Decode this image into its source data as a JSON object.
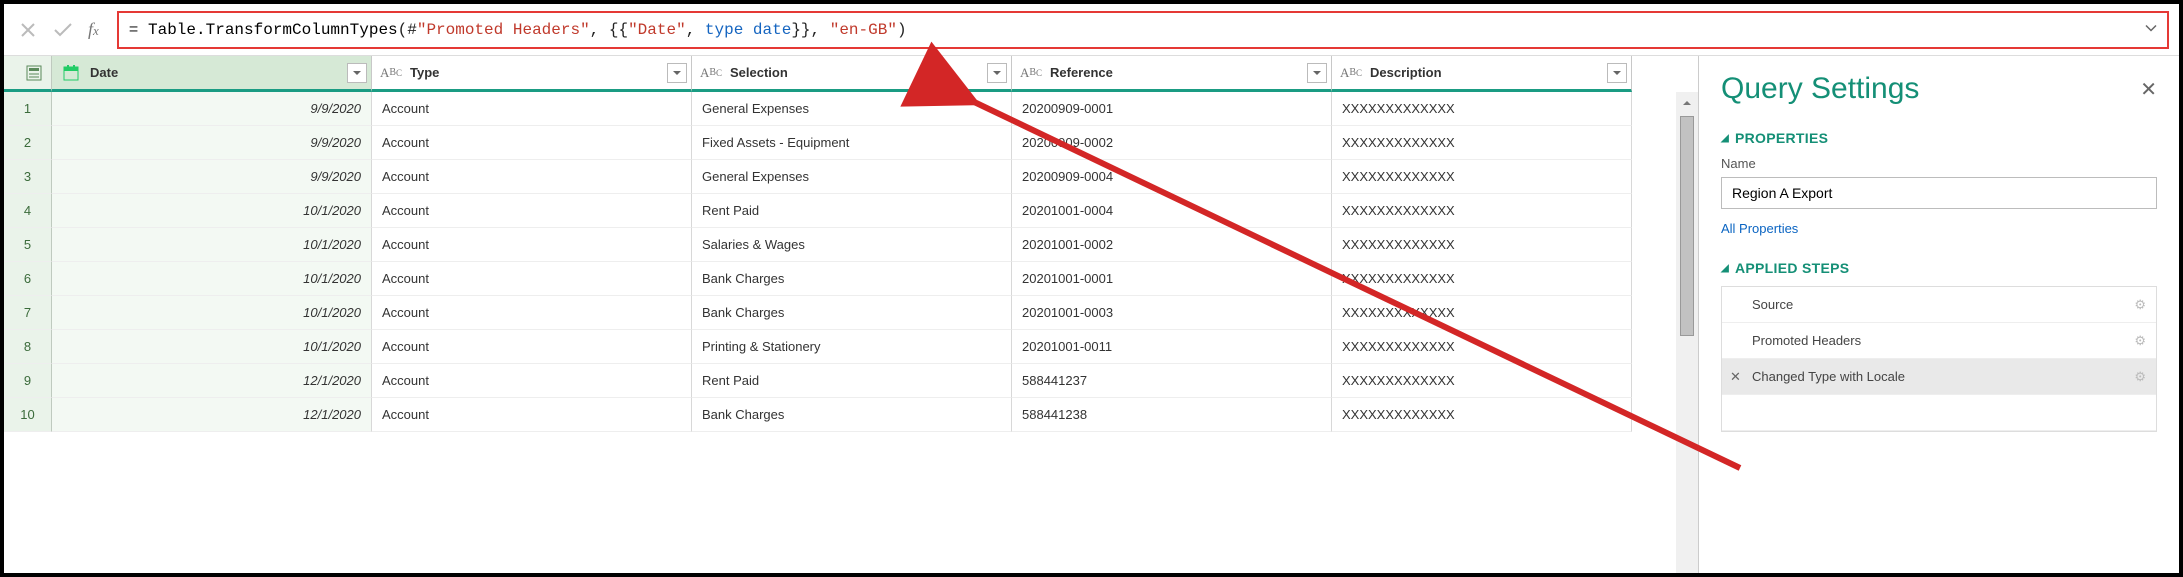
{
  "formula": {
    "prefix": "= ",
    "fn1": "Table.TransformColumnTypes",
    "open": "(#",
    "str1": "\"Promoted Headers\"",
    "mid1": ", {{",
    "str2": "\"Date\"",
    "mid2": ", ",
    "kw": "type ",
    "kw2": "date",
    "mid3": "}}, ",
    "str3": "\"en-GB\"",
    "close": ")"
  },
  "columns": {
    "date": "Date",
    "type": "Type",
    "selection": "Selection",
    "reference": "Reference",
    "description": "Description"
  },
  "rows": [
    {
      "n": "1",
      "date": "9/9/2020",
      "type": "Account",
      "sel": "General Expenses",
      "ref": "20200909-0001",
      "desc": "XXXXXXXXXXXXX"
    },
    {
      "n": "2",
      "date": "9/9/2020",
      "type": "Account",
      "sel": "Fixed Assets - Equipment",
      "ref": "20200909-0002",
      "desc": "XXXXXXXXXXXXX"
    },
    {
      "n": "3",
      "date": "9/9/2020",
      "type": "Account",
      "sel": "General Expenses",
      "ref": "20200909-0004",
      "desc": "XXXXXXXXXXXXX"
    },
    {
      "n": "4",
      "date": "10/1/2020",
      "type": "Account",
      "sel": "Rent Paid",
      "ref": "20201001-0004",
      "desc": "XXXXXXXXXXXXX"
    },
    {
      "n": "5",
      "date": "10/1/2020",
      "type": "Account",
      "sel": "Salaries & Wages",
      "ref": "20201001-0002",
      "desc": "XXXXXXXXXXXXX"
    },
    {
      "n": "6",
      "date": "10/1/2020",
      "type": "Account",
      "sel": "Bank Charges",
      "ref": "20201001-0001",
      "desc": "XXXXXXXXXXXXX"
    },
    {
      "n": "7",
      "date": "10/1/2020",
      "type": "Account",
      "sel": "Bank Charges",
      "ref": "20201001-0003",
      "desc": "XXXXXXXXXXXXX"
    },
    {
      "n": "8",
      "date": "10/1/2020",
      "type": "Account",
      "sel": "Printing & Stationery",
      "ref": "20201001-0011",
      "desc": "XXXXXXXXXXXXX"
    },
    {
      "n": "9",
      "date": "12/1/2020",
      "type": "Account",
      "sel": "Rent Paid",
      "ref": "588441237",
      "desc": "XXXXXXXXXXXXX"
    },
    {
      "n": "10",
      "date": "12/1/2020",
      "type": "Account",
      "sel": "Bank Charges",
      "ref": "588441238",
      "desc": "XXXXXXXXXXXXX"
    }
  ],
  "panel": {
    "title": "Query Settings",
    "sections": {
      "properties": "PROPERTIES",
      "applied": "APPLIED STEPS"
    },
    "name_label": "Name",
    "name_value": "Region A Export",
    "all_props": "All Properties",
    "steps": [
      {
        "label": "Source",
        "gear": true
      },
      {
        "label": "Promoted Headers",
        "gear": true
      },
      {
        "label": "Changed Type with Locale",
        "gear": true,
        "selected": true,
        "deletable": true
      }
    ]
  }
}
